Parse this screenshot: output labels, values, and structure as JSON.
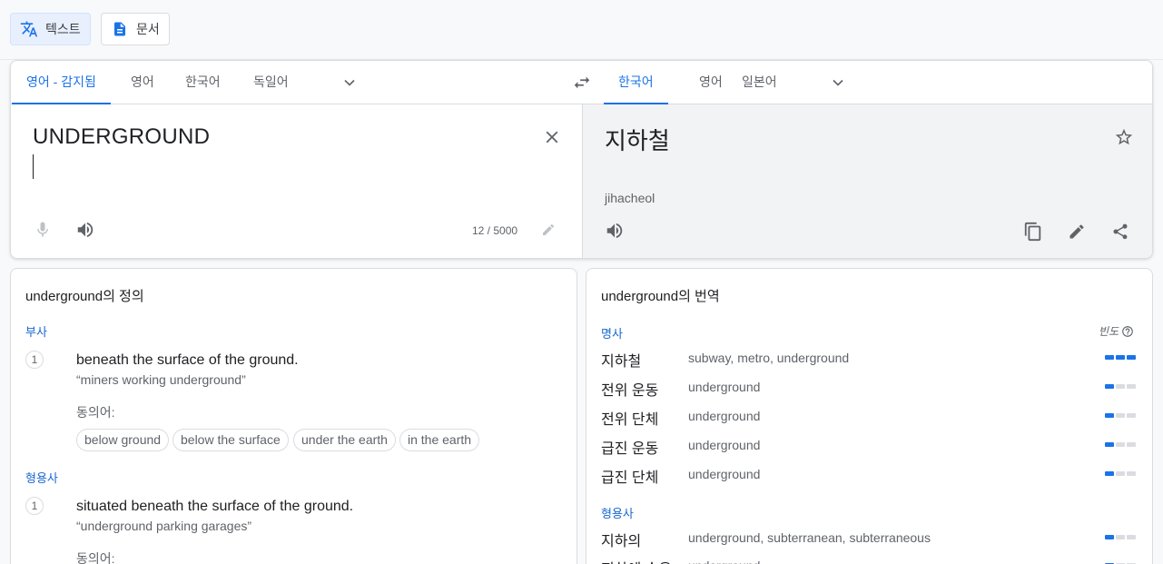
{
  "modes": {
    "text_label": "텍스트",
    "document_label": "문서"
  },
  "source_langs": [
    "영어 - 감지됨",
    "영어",
    "한국어",
    "독일어"
  ],
  "target_langs": [
    "한국어",
    "영어",
    "일본어"
  ],
  "source": {
    "text": "UNDERGROUND",
    "counter": "12 / 5000"
  },
  "target": {
    "text": "지하철",
    "romanization": "jihacheol"
  },
  "definitions": {
    "title": "underground의 정의",
    "groups": [
      {
        "pos": "부사",
        "items": [
          {
            "num": "1",
            "text": "beneath the surface of the ground.",
            "example": "“miners working underground”",
            "syn_label": "동의어:",
            "synonyms": [
              "below ground",
              "below the surface",
              "under the earth",
              "in the earth"
            ]
          }
        ]
      },
      {
        "pos": "형용사",
        "items": [
          {
            "num": "1",
            "text": "situated beneath the surface of the ground.",
            "example": "“underground parking garages”",
            "syn_label": "동의어:"
          }
        ]
      }
    ]
  },
  "translations": {
    "title": "underground의 번역",
    "freq_label": "빈도",
    "groups": [
      {
        "pos": "명사",
        "rows": [
          {
            "word": "지하철",
            "syn": "subway, metro, underground",
            "freq": 3
          },
          {
            "word": "전위 운동",
            "syn": "underground",
            "freq": 1
          },
          {
            "word": "전위 단체",
            "syn": "underground",
            "freq": 1
          },
          {
            "word": "급진 운동",
            "syn": "underground",
            "freq": 1
          },
          {
            "word": "급진 단체",
            "syn": "underground",
            "freq": 1
          }
        ]
      },
      {
        "pos": "형용사",
        "rows": [
          {
            "word": "지하의",
            "syn": "underground, subterranean, subterraneous",
            "freq": 1
          },
          {
            "word": "지하에 숨은",
            "syn": "underground",
            "freq": 1
          }
        ]
      }
    ]
  },
  "colors": {
    "accent": "#1a73e8",
    "pos": "#1967d2",
    "target_bg": "#f1f3f4"
  }
}
